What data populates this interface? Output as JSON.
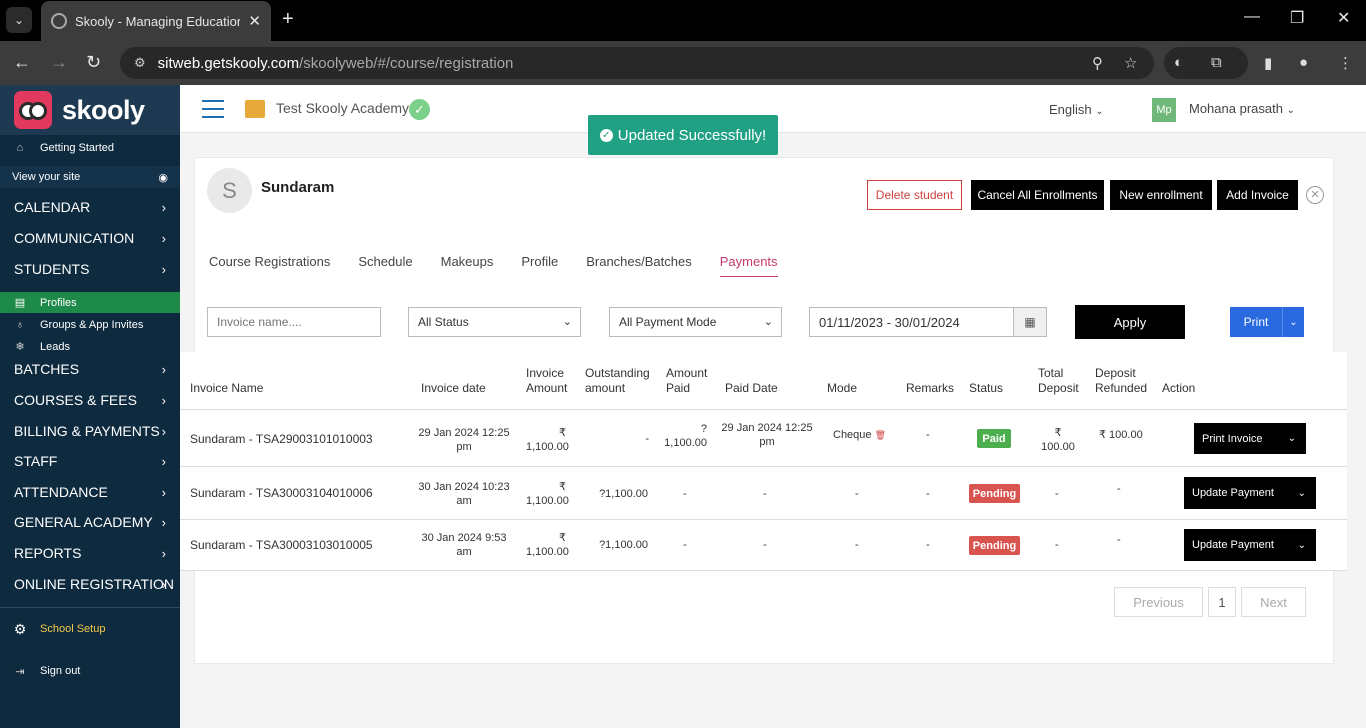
{
  "browser": {
    "tab_title": "Skooly - Managing Educational",
    "url_host": "sitweb.getskooly.com",
    "url_path": "/skoolyweb/#/course/registration"
  },
  "sidebar": {
    "brand": "skooly",
    "getting_started": "Getting Started",
    "view_site": "View your site",
    "menu": [
      {
        "label": "CALENDAR"
      },
      {
        "label": "COMMUNICATION"
      },
      {
        "label": "STUDENTS"
      }
    ],
    "student_sub": [
      {
        "label": "Profiles"
      },
      {
        "label": "Groups & App Invites"
      },
      {
        "label": "Leads"
      }
    ],
    "menu2": [
      {
        "label": "BATCHES"
      },
      {
        "label": "COURSES & FEES"
      },
      {
        "label": "BILLING & PAYMENTS"
      },
      {
        "label": "STAFF"
      },
      {
        "label": "ATTENDANCE"
      },
      {
        "label": "GENERAL ACADEMY"
      },
      {
        "label": "REPORTS"
      },
      {
        "label": "ONLINE REGISTRATION"
      }
    ],
    "school_setup": "School Setup",
    "sign_out": "Sign out"
  },
  "header": {
    "academy": "Test Skooly Academy",
    "language": "English",
    "avatar_initials": "Mp",
    "user": "Mohana prasath"
  },
  "toast": "Updated Successfully!",
  "student": {
    "initial": "S",
    "name": "Sundaram",
    "actions": {
      "delete": "Delete student",
      "cancel_all": "Cancel All Enrollments",
      "new_enrollment": "New enrollment",
      "add_invoice": "Add Invoice"
    }
  },
  "tabs": [
    "Course Registrations",
    "Schedule",
    "Makeups",
    "Profile",
    "Branches/Batches",
    "Payments"
  ],
  "filters": {
    "invoice_placeholder": "Invoice name....",
    "status": "All Status",
    "mode": "All Payment Mode",
    "date_range": "01/11/2023 - 30/01/2024",
    "apply": "Apply",
    "print": "Print"
  },
  "table": {
    "headers": {
      "invoice_name": "Invoice Name",
      "invoice_date": "Invoice date",
      "invoice_amount_1": "Invoice",
      "invoice_amount_2": "Amount",
      "outstanding_1": "Outstanding",
      "outstanding_2": "amount",
      "amount_paid_1": "Amount",
      "amount_paid_2": "Paid",
      "paid_date": "Paid Date",
      "mode": "Mode",
      "remarks": "Remarks",
      "status": "Status",
      "total_deposit_1": "Total",
      "total_deposit_2": "Deposit",
      "deposit_refunded_1": "Deposit",
      "deposit_refunded_2": "Refunded",
      "action": "Action"
    },
    "rows": [
      {
        "name": "Sundaram - TSA29003101010003",
        "date_1": "29 Jan 2024 12:25",
        "date_2": "pm",
        "amount_1": "₹",
        "amount_2": "1,100.00",
        "outstanding": "-",
        "paid_1": "?",
        "paid_2": "1,100.00",
        "paid_date_1": "29 Jan 2024 12:25",
        "paid_date_2": "pm",
        "mode": "Cheque",
        "remarks": "-",
        "status": "Paid",
        "deposit_1": "₹",
        "deposit_2": "100.00",
        "refunded": "₹ 100.00",
        "action": "Print Invoice"
      },
      {
        "name": "Sundaram - TSA30003104010006",
        "date_1": "30 Jan 2024 10:23",
        "date_2": "am",
        "amount_1": "₹",
        "amount_2": "1,100.00",
        "outstanding": "?1,100.00",
        "paid_1": "-",
        "paid_2": "",
        "paid_date_1": "-",
        "paid_date_2": "",
        "mode": "-",
        "remarks": "-",
        "status": "Pending",
        "deposit_1": "-",
        "deposit_2": "",
        "refunded": "-",
        "action": "Update Payment"
      },
      {
        "name": "Sundaram - TSA30003103010005",
        "date_1": "30 Jan 2024 9:53",
        "date_2": "am",
        "amount_1": "₹",
        "amount_2": "1,100.00",
        "outstanding": "?1,100.00",
        "paid_1": "-",
        "paid_2": "",
        "paid_date_1": "-",
        "paid_date_2": "",
        "mode": "-",
        "remarks": "-",
        "status": "Pending",
        "deposit_1": "-",
        "deposit_2": "",
        "refunded": "-",
        "action": "Update Payment"
      }
    ]
  },
  "pagination": {
    "previous": "Previous",
    "page": "1",
    "next": "Next"
  },
  "colors": {
    "sidebar_bg": "#0e2a3f",
    "active_green": "#1e8a4a",
    "toast_green": "#20a184",
    "accent_pink": "#c43a6e",
    "print_blue": "#2a6ae0",
    "school_setup_yellow": "#f2c94c"
  }
}
